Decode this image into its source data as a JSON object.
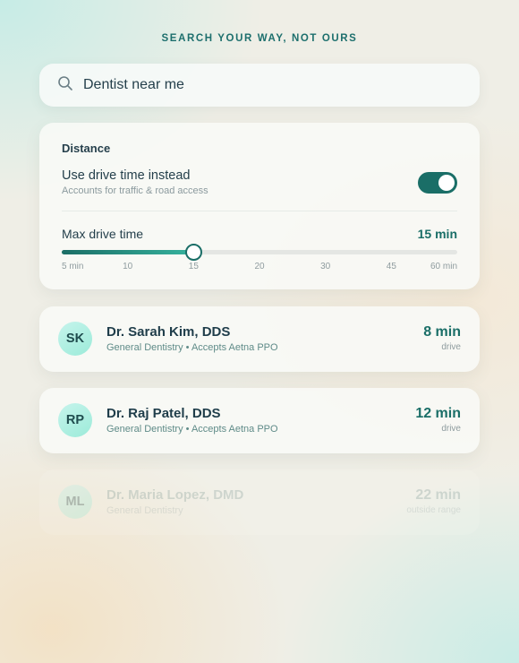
{
  "header": {
    "eyebrow": "SEARCH YOUR WAY, NOT OURS"
  },
  "search": {
    "value": "Dentist near me",
    "icon": "search-icon"
  },
  "distance": {
    "title": "Distance",
    "toggle_label": "Use drive time instead",
    "toggle_sublabel": "Accounts for traffic & road access",
    "toggle_on": true,
    "max_label": "Max drive time",
    "max_value": "15 min",
    "slider_ticks": [
      "5 min",
      "10",
      "15",
      "20",
      "30",
      "45",
      "60 min"
    ],
    "slider_selected_index": 2
  },
  "results": [
    {
      "initials": "SK",
      "name": "Dr. Sarah Kim, DDS",
      "details": "General Dentistry • Accepts Aetna PPO",
      "time": "8 min",
      "time_label": "drive",
      "in_range": true
    },
    {
      "initials": "RP",
      "name": "Dr. Raj Patel, DDS",
      "details": "General Dentistry • Accepts Aetna PPO",
      "time": "12 min",
      "time_label": "drive",
      "in_range": true
    },
    {
      "initials": "ML",
      "name": "Dr. Maria Lopez, DMD",
      "details": "General Dentistry",
      "time": "22 min",
      "time_label": "outside range",
      "in_range": false
    }
  ],
  "colors": {
    "accent": "#1a6e67",
    "accent_light": "#36b39e",
    "avatar": "#b3f0e4"
  }
}
